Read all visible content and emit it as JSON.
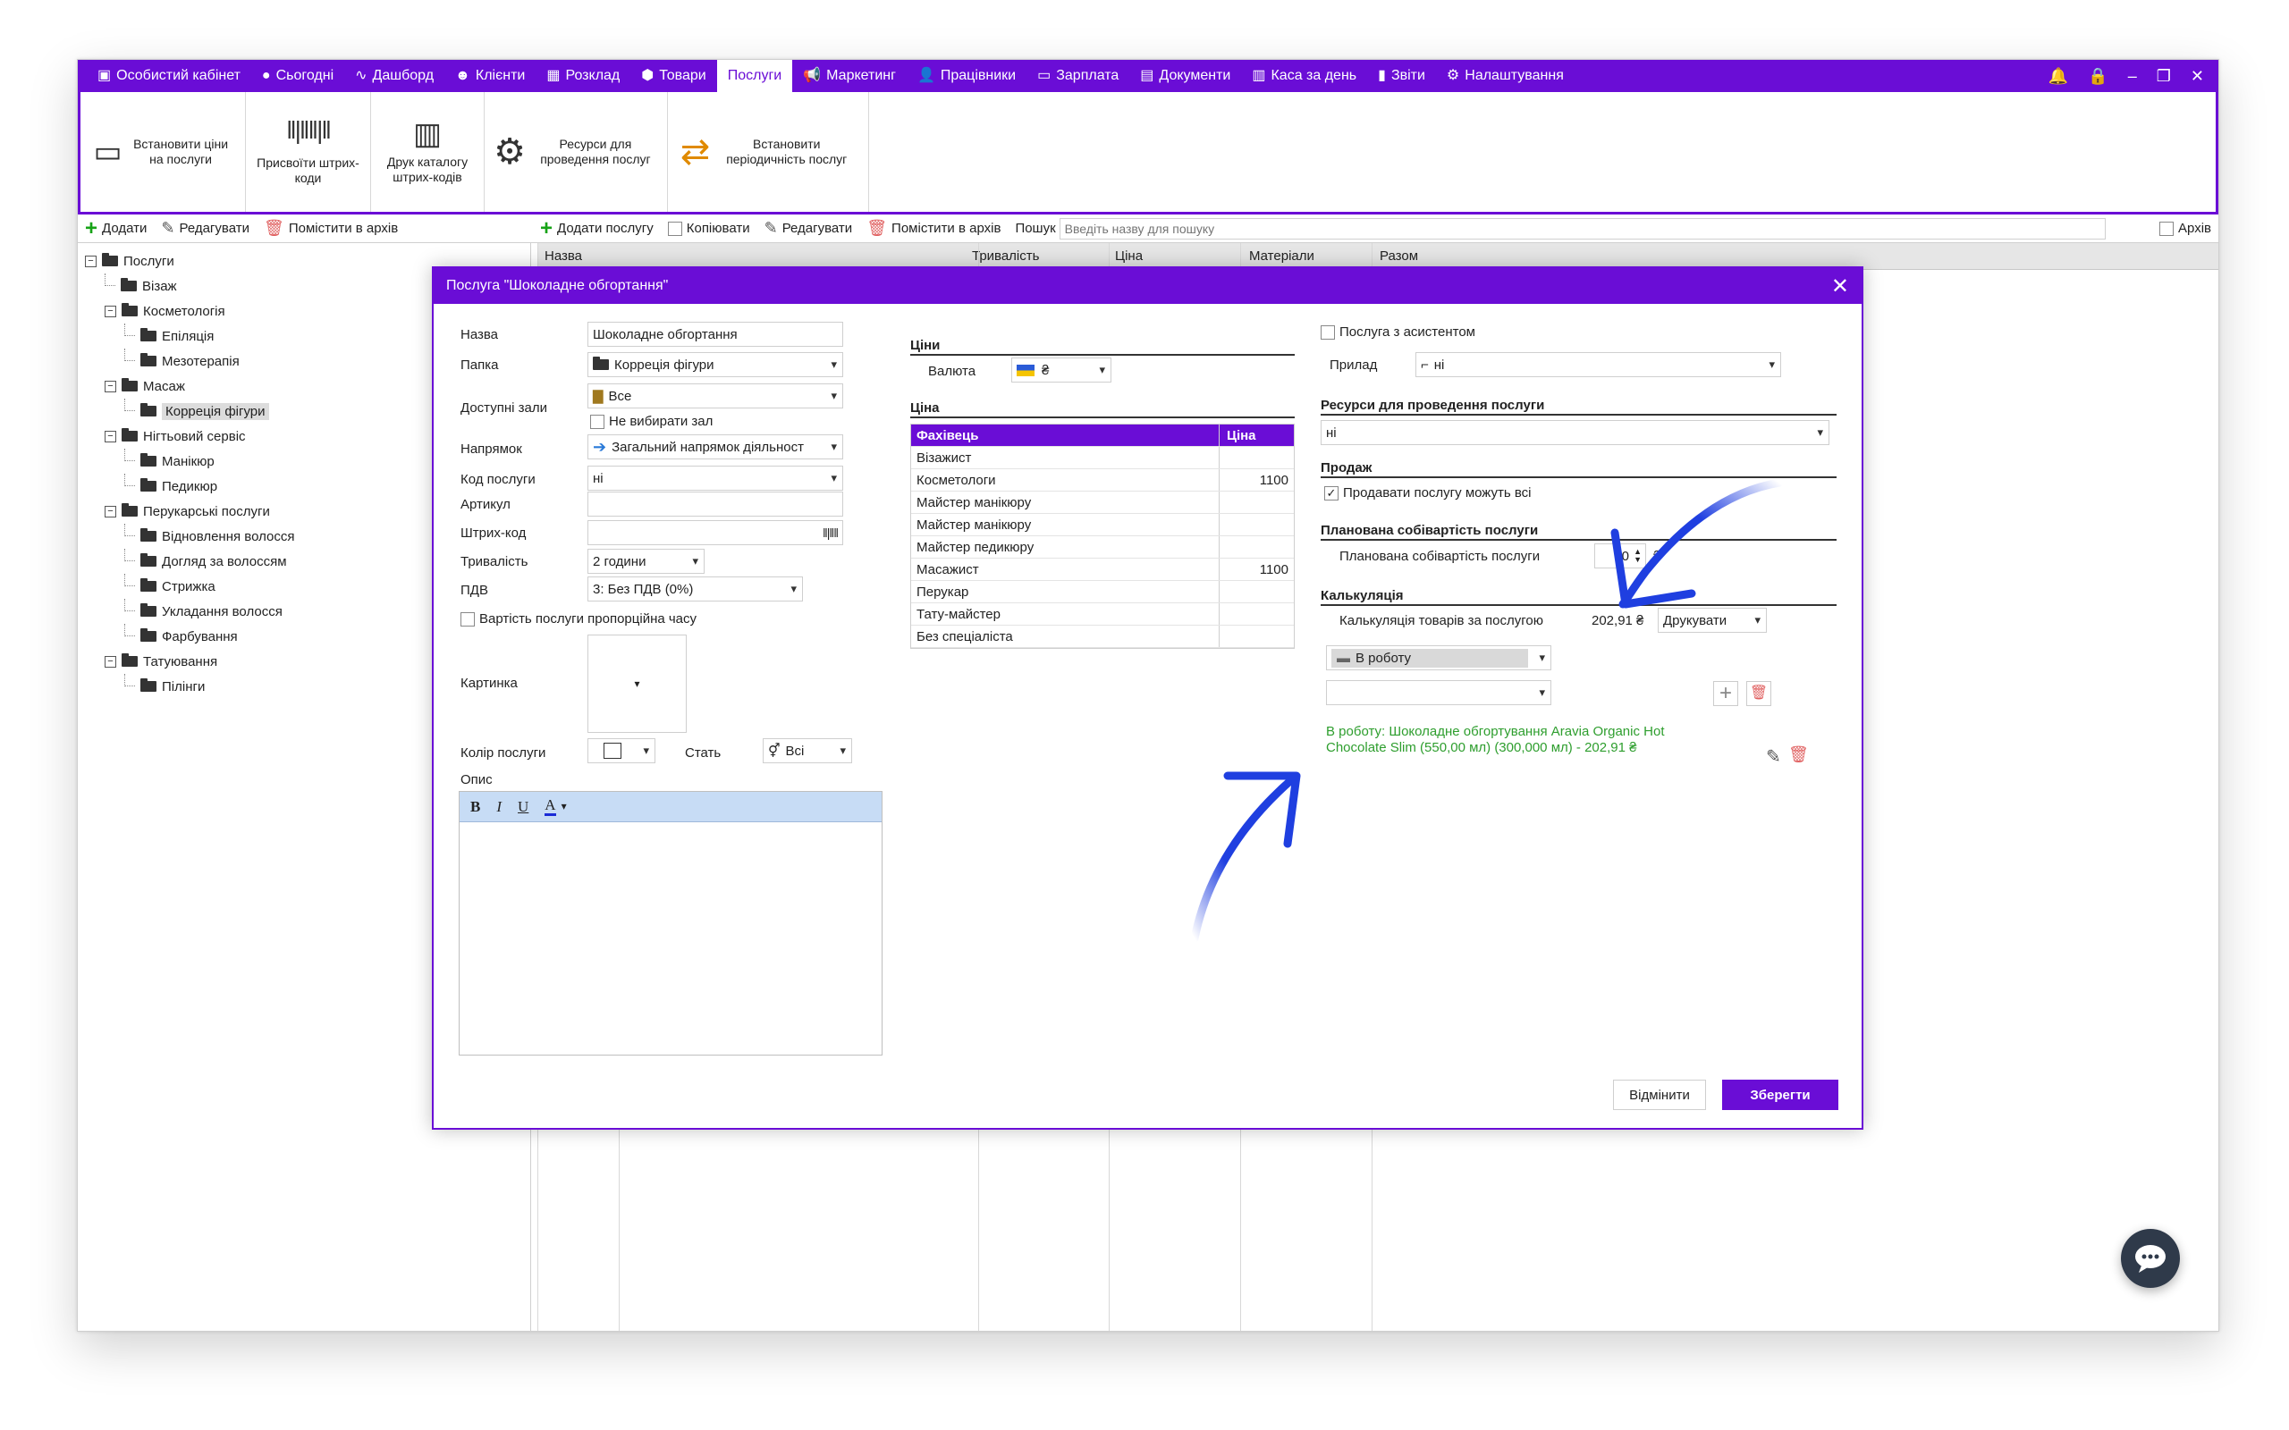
{
  "menu": {
    "items": [
      {
        "icon": "▣",
        "label": "Особистий кабінет"
      },
      {
        "icon": "●",
        "label": "Сьогодні"
      },
      {
        "icon": "∿",
        "label": "Дашборд"
      },
      {
        "icon": "☻",
        "label": "Клієнти"
      },
      {
        "icon": "▦",
        "label": "Розклад"
      },
      {
        "icon": "⬢",
        "label": "Товари"
      },
      {
        "icon": "",
        "label": "Послуги"
      },
      {
        "icon": "📢",
        "label": "Маркетинг"
      },
      {
        "icon": "👤",
        "label": "Працівники"
      },
      {
        "icon": "▭",
        "label": "Зарплата"
      },
      {
        "icon": "▤",
        "label": "Документи"
      },
      {
        "icon": "▥",
        "label": "Каса за день"
      },
      {
        "icon": "▮",
        "label": "Звіти"
      },
      {
        "icon": "⚙",
        "label": "Налаштування"
      }
    ],
    "active": "Послуги"
  },
  "ribbon": {
    "set_prices": "Встановити ціни на послуги",
    "assign_barcodes": "Присвоїти штрих-коди",
    "print_catalog": "Друк каталогу штрих-кодів",
    "resources": "Ресурси для проведення послуг",
    "periodicity": "Встановити періодичність послуг"
  },
  "left_toolbar": {
    "add": "Додати",
    "edit": "Редагувати",
    "archive": "Помістити в архів"
  },
  "tree": [
    {
      "label": "Послуги",
      "level": 0,
      "box": "−"
    },
    {
      "label": "Візаж",
      "level": 1,
      "box": ""
    },
    {
      "label": "Косметологія",
      "level": 1,
      "box": "−"
    },
    {
      "label": "Епіляція",
      "level": 2,
      "box": ""
    },
    {
      "label": "Мезотерапія",
      "level": 2,
      "box": ""
    },
    {
      "label": "Масаж",
      "level": 1,
      "box": "−"
    },
    {
      "label": "Корреція фігури",
      "level": 2,
      "box": "",
      "selected": true
    },
    {
      "label": "Нігтьовий сервіс",
      "level": 1,
      "box": "−"
    },
    {
      "label": "Манікюр",
      "level": 2,
      "box": ""
    },
    {
      "label": "Педикюр",
      "level": 2,
      "box": ""
    },
    {
      "label": "Перукарські послуги",
      "level": 1,
      "box": "−"
    },
    {
      "label": "Відновлення волосся",
      "level": 2,
      "box": ""
    },
    {
      "label": "Догляд за волоссям",
      "level": 2,
      "box": ""
    },
    {
      "label": "Стрижка",
      "level": 2,
      "box": ""
    },
    {
      "label": "Укладання волосся",
      "level": 2,
      "box": ""
    },
    {
      "label": "Фарбування",
      "level": 2,
      "box": ""
    },
    {
      "label": "Татуювання",
      "level": 1,
      "box": "−"
    },
    {
      "label": "Пілінги",
      "level": 2,
      "box": ""
    }
  ],
  "right_toolbar": {
    "add_service": "Додати послугу",
    "copy": "Копіювати",
    "edit": "Редагувати",
    "archive": "Помістити в архів",
    "search_label": "Пошук",
    "search_placeholder": "Введіть назву для пошуку",
    "archive_check": "Архів"
  },
  "table": {
    "headers": [
      "Назва",
      "Тривалість",
      "Ціна",
      "Матеріали",
      "Разом"
    ]
  },
  "dialog": {
    "title": "Послуга \"Шоколадне обгортання\"",
    "name_label": "Назва",
    "name_value": "Шоколадне обгортання",
    "folder_label": "Папка",
    "folder_value": "Корреція фігури",
    "halls_label": "Доступні зали",
    "halls_value": "Все",
    "no_hall": "Не вибирати зал",
    "direction_label": "Напрямок",
    "direction_value": "Загальний напрямок діяльност",
    "code_label": "Код послуги",
    "code_value": "ні",
    "article_label": "Артикул",
    "barcode_label": "Штрих-код",
    "duration_label": "Тривалість",
    "duration_value": "2 години",
    "vat_label": "ПДВ",
    "vat_value": "3: Без ПДВ (0%)",
    "proportional": "Вартість послуги пропорційна часу",
    "picture_label": "Картинка",
    "color_label": "Колір послуги",
    "gender_label": "Стать",
    "gender_value": "Всі",
    "desc_label": "Опис",
    "prices_title": "Ціни",
    "currency_label": "Валюта",
    "currency_value": "₴",
    "price_title": "Ціна",
    "price_head": [
      "Фахівець",
      "Ціна"
    ],
    "price_rows": [
      [
        "Візажист",
        ""
      ],
      [
        "Косметологи",
        "1100"
      ],
      [
        "Майстер манікюру",
        ""
      ],
      [
        "Майстер манікюру",
        ""
      ],
      [
        "Майстер педикюру",
        ""
      ],
      [
        "Масажист",
        "1100"
      ],
      [
        "Перукар",
        ""
      ],
      [
        "Тату-майстер",
        ""
      ],
      [
        "Без спеціаліста",
        ""
      ]
    ],
    "assistant": "Послуга з асистентом",
    "device_label": "Прилад",
    "device_value": "ні",
    "resources_title": "Ресурси для проведення послуги",
    "resources_value": "ні",
    "sale_title": "Продаж",
    "sale_all": "Продавати послугу можуть всі",
    "cost_title": "Планована собівартість послуги",
    "cost_label": "Планована собівартість послуги",
    "cost_value": "0",
    "cost_currency": "₴",
    "calc_title": "Калькуляція",
    "calc_label": "Калькуляція товарів за послугою",
    "calc_value": "202,91 ₴",
    "print_value": "Друкувати",
    "work_value": "В роботу",
    "work_line": "В роботу: Шоколадне обгортування Aravia Organic Hot Chocolate Slim (550,00 мл) (300,000 мл) - 202,91 ₴",
    "cancel": "Відмінити",
    "save": "Зберегти"
  },
  "colors": {
    "accent": "#6a0dd6",
    "green_text": "#2e9e2e",
    "arrow": "#1f3fe0"
  }
}
